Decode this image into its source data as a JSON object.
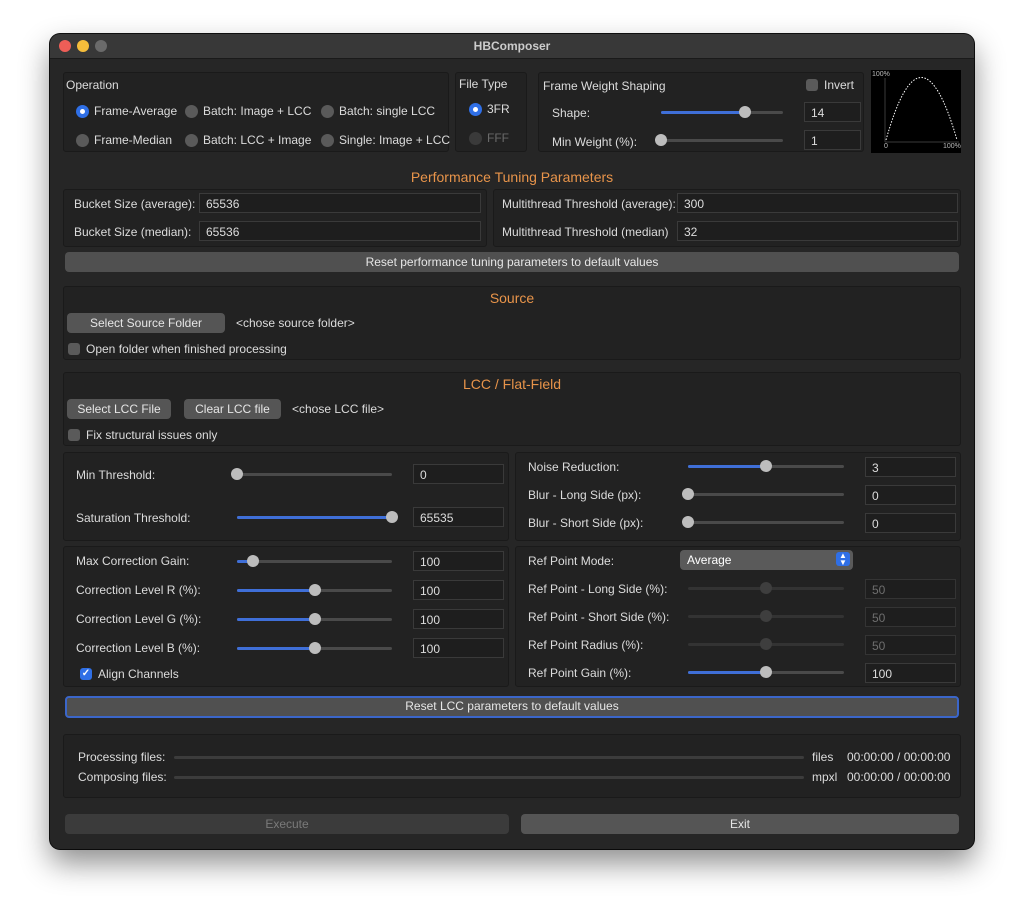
{
  "window": {
    "title": "HBComposer"
  },
  "operation": {
    "title": "Operation",
    "options": [
      {
        "label": "Frame-Average",
        "selected": true
      },
      {
        "label": "Batch: Image + LCC",
        "selected": false
      },
      {
        "label": "Batch: single LCC",
        "selected": false
      },
      {
        "label": "Frame-Median",
        "selected": false
      },
      {
        "label": "Batch: LCC + Image",
        "selected": false
      },
      {
        "label": "Single: Image + LCC",
        "selected": false
      }
    ]
  },
  "file_type": {
    "title": "File Type",
    "options": [
      {
        "label": "3FR",
        "selected": true,
        "enabled": true
      },
      {
        "label": "FFF",
        "selected": false,
        "enabled": false
      }
    ]
  },
  "frame_weight": {
    "title": "Frame Weight Shaping",
    "invert_label": "Invert",
    "invert_checked": false,
    "shape_label": "Shape:",
    "shape_value": "14",
    "shape_level": 0.69,
    "min_weight_label": "Min Weight (%):",
    "min_weight_value": "1",
    "min_weight_level": 0.0,
    "preview": {
      "y_top": "100%",
      "x_min": "0",
      "x_max": "100%"
    }
  },
  "performance": {
    "title": "Performance Tuning Parameters",
    "bucket_avg_label": "Bucket Size (average):",
    "bucket_avg_value": "65536",
    "bucket_med_label": "Bucket Size (median):",
    "bucket_med_value": "65536",
    "mt_avg_label": "Multithread Threshold (average):",
    "mt_avg_value": "300",
    "mt_med_label": "Multithread Threshold (median)",
    "mt_med_value": "32",
    "reset_label": "Reset performance tuning parameters to default values"
  },
  "source": {
    "title": "Source",
    "select_label": "Select Source Folder",
    "path_text": "<chose source folder>",
    "open_when_done_label": "Open folder when finished processing",
    "open_when_done_checked": false
  },
  "lcc": {
    "title": "LCC / Flat-Field",
    "select_label": "Select LCC File",
    "clear_label": "Clear LCC file",
    "file_text": "<chose LCC file>",
    "fix_structural_label": "Fix structural issues only",
    "fix_structural_checked": false,
    "min_threshold": {
      "label": "Min Threshold:",
      "value": "0",
      "level": 0.0
    },
    "saturation_threshold": {
      "label": "Saturation Threshold:",
      "value": "65535",
      "level": 1.0
    },
    "noise_reduction": {
      "label": "Noise Reduction:",
      "value": "3",
      "level": 0.5
    },
    "blur_long": {
      "label": "Blur - Long Side (px):",
      "value": "0",
      "level": 0.0
    },
    "blur_short": {
      "label": "Blur - Short Side (px):",
      "value": "0",
      "level": 0.0
    },
    "max_correction_gain": {
      "label": "Max Correction Gain:",
      "value": "100",
      "level": 0.1
    },
    "correction_r": {
      "label": "Correction Level R (%):",
      "value": "100",
      "level": 0.5
    },
    "correction_g": {
      "label": "Correction Level G (%):",
      "value": "100",
      "level": 0.5
    },
    "correction_b": {
      "label": "Correction Level B (%):",
      "value": "100",
      "level": 0.5
    },
    "align_channels_label": "Align Channels",
    "align_channels_checked": true,
    "ref_point_mode": {
      "label": "Ref Point Mode:",
      "value": "Average"
    },
    "ref_long": {
      "label": "Ref Point - Long Side (%):",
      "value": "50",
      "level": 0.5
    },
    "ref_short": {
      "label": "Ref Point - Short Side (%):",
      "value": "50",
      "level": 0.5
    },
    "ref_radius": {
      "label": "Ref Point Radius (%):",
      "value": "50",
      "level": 0.5
    },
    "ref_gain": {
      "label": "Ref Point Gain (%):",
      "value": "100",
      "level": 0.5
    },
    "reset_label": "Reset LCC parameters to default values"
  },
  "progress": {
    "processing_label": "Processing files:",
    "processing_unit": "files",
    "processing_time": "00:00:00 / 00:00:00",
    "processing_level": 0.0,
    "composing_label": "Composing files:",
    "composing_unit": "mpxl",
    "composing_time": "00:00:00 / 00:00:00",
    "composing_level": 0.0
  },
  "actions": {
    "execute_label": "Execute",
    "exit_label": "Exit"
  },
  "colors": {
    "accent": "#e8944a",
    "highlight": "#2f6fe6",
    "window_bg": "#262626"
  }
}
